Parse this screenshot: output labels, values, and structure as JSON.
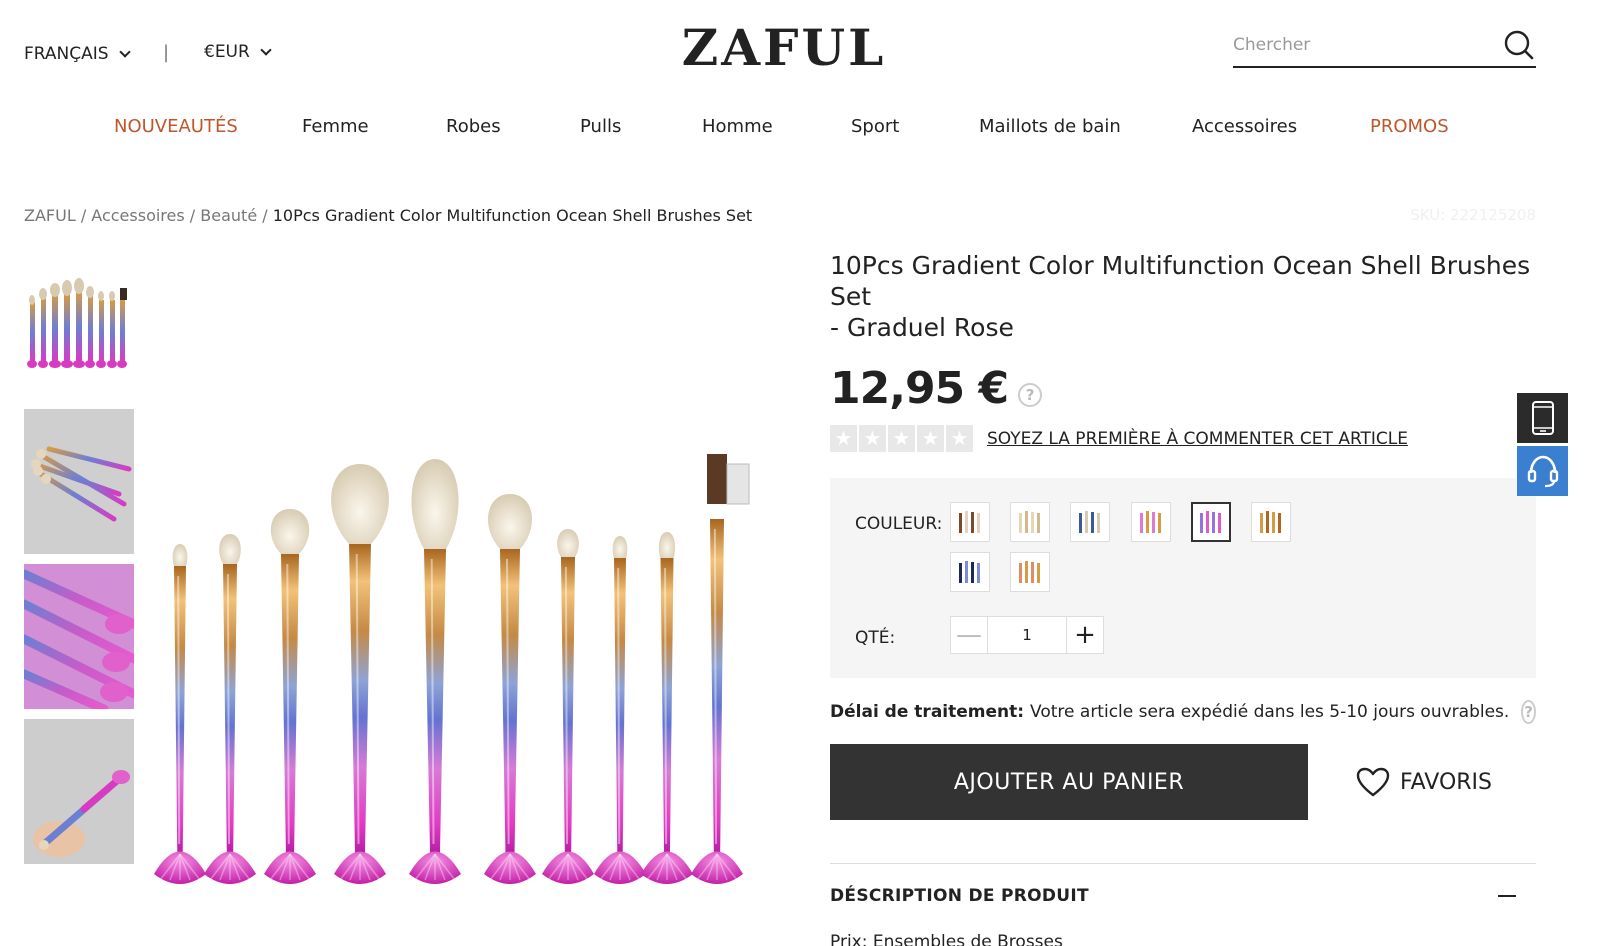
{
  "header": {
    "language": "FRANÇAIS",
    "separator": "|",
    "currency": "€EUR",
    "logo": "ZAFUL",
    "search_placeholder": "Chercher"
  },
  "nav": [
    {
      "label": "NOUVEAUTÉS",
      "accent": true
    },
    {
      "label": "Femme",
      "accent": false
    },
    {
      "label": "Robes",
      "accent": false
    },
    {
      "label": "Pulls",
      "accent": false
    },
    {
      "label": "Homme",
      "accent": false
    },
    {
      "label": "Sport",
      "accent": false
    },
    {
      "label": "Maillots de bain",
      "accent": false
    },
    {
      "label": "Accessoires",
      "accent": false
    },
    {
      "label": "PROMOS",
      "accent": true
    }
  ],
  "breadcrumb": {
    "items": [
      "ZAFUL",
      "Accessoires",
      "Beauté"
    ],
    "separator": " / ",
    "current": "10Pcs Gradient Color Multifunction Ocean Shell Brushes Set"
  },
  "sku": "SKU: 222125208",
  "product": {
    "title_line1": "10Pcs Gradient Color Multifunction Ocean Shell Brushes Set",
    "title_line2": "- Graduel Rose",
    "price": "12,95 €",
    "help": "?",
    "rating_stars": 0,
    "review_link": "SOYEZ LA PREMIÈRE À COMMENTER CET ARTICLE",
    "color_label": "COULEUR:",
    "color_count": 8,
    "selected_color_index": 4,
    "qty_label": "QTÉ:",
    "qty_value": "1",
    "qty_minus": "—",
    "qty_plus": "+",
    "delay_label": "Délai de traitement:",
    "delay_text": "Votre article sera expédié dans les 5-10 jours ouvrables.",
    "add_to_cart": "AJOUTER AU PANIER",
    "favorites": "FAVORIS",
    "description_title": "DÉSCRIPTION DE PRODUIT",
    "description_line": "Prix: Ensembles de Brosses"
  },
  "colors": {
    "accent": "#c0562b",
    "cart_button": "#333333",
    "chat_float": "#3b7fd0",
    "phone_float": "#2b2b2b"
  },
  "icons": {
    "search": "search-icon",
    "help": "help-icon",
    "heart": "heart-icon",
    "phone": "phone-icon",
    "chat": "headset-icon"
  }
}
